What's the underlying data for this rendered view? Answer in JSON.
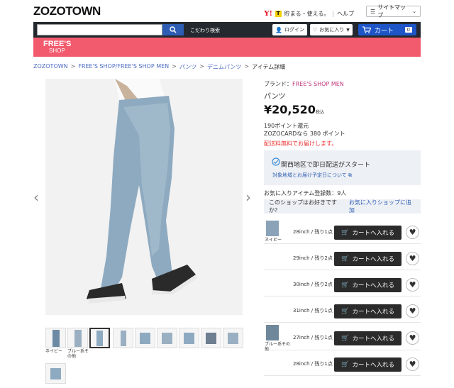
{
  "header": {
    "logo": "ZOZOTOWN",
    "promo_text": "貯まる・使える。",
    "help": "ヘルプ",
    "sitemap": "サイトマップ"
  },
  "nav": {
    "search_placeholder": "",
    "kodawari": "こだわり検索",
    "login": "ログイン",
    "favorites": "お気に入り",
    "cart": "カート",
    "cart_count": "0"
  },
  "shop": {
    "line1": "FREE'S",
    "line2": "SHOP"
  },
  "breadcrumb": [
    "ZOZOTOWN",
    "FREE'S SHOP/FREE'S SHOP MEN",
    "パンツ",
    "デニムパンツ",
    "アイテム詳細"
  ],
  "product": {
    "brand_label": "ブランド：",
    "brand": "FREE'S SHOP MEN",
    "name": "パンツ",
    "price": "¥20,520",
    "tax": "税込",
    "points1": "190ポイント還元",
    "points2": "ZOZOCARDなら 380 ポイント",
    "shipping": "配送料無料でお届けします。",
    "delivery_title": "関西地区で即日配送がスタート",
    "delivery_link": "対象地域とお届け予定日について",
    "favorites_count": "お気に入りアイテム登録数：9人",
    "shop_question": "このショップはお好きですか？",
    "shop_fav_link": "お気に入りショップに追加"
  },
  "thumb_captions": {
    "t1": "ネイビー",
    "t2a": "ブルー系そ",
    "t2b": "の他"
  },
  "cart_label": "カートへ入れる",
  "variants": [
    {
      "color": "ネイビー",
      "size": "28inch / 残り1点"
    },
    {
      "color": "",
      "size": "29inch / 残り2点"
    },
    {
      "color": "",
      "size": "30inch / 残り2点"
    },
    {
      "color": "",
      "size": "31inch / 残り1点"
    },
    {
      "color": "ブルー系その他",
      "size": "27inch / 残り1点"
    },
    {
      "color": "",
      "size": "28inch / 残り1点"
    }
  ],
  "colors": {
    "nav": "#24292f",
    "shop_bar": "#f25a6d",
    "cart": "#1e56c8",
    "link": "#4a6cc0",
    "brand": "#c0367b"
  }
}
